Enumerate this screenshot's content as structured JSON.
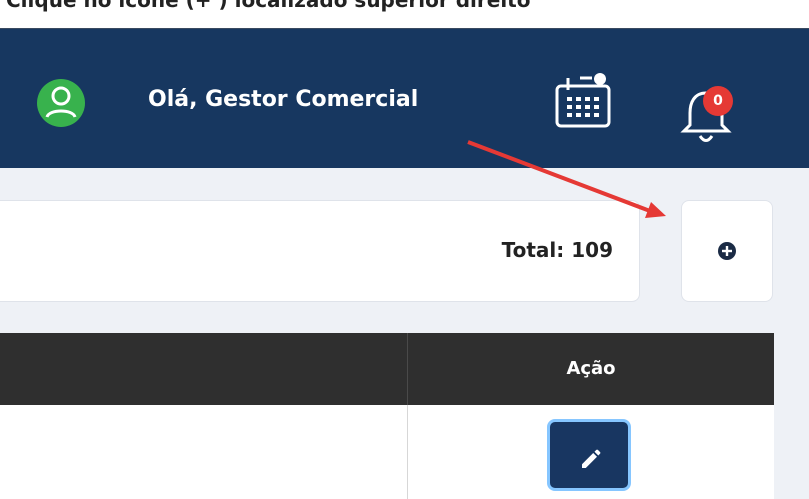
{
  "caption": {
    "text": "Clique no ícone (+ ) localizado superior direito"
  },
  "header": {
    "greeting": "Olá, Gestor Comercial",
    "notification_count": "0",
    "avatar_icon": "user-avatar-icon",
    "calendar_icon": "calendar-icon",
    "bell_icon": "bell-icon",
    "colors": {
      "background": "#173760",
      "avatar": "#38b24d",
      "badge": "#e53935"
    }
  },
  "summary": {
    "total_label": "Total: 109"
  },
  "toolbar": {
    "add_icon": "plus-circle-icon"
  },
  "table": {
    "action_header": "Ação",
    "edit_icon": "pencil-icon"
  },
  "annotation": {
    "arrow_color": "#e53935"
  }
}
